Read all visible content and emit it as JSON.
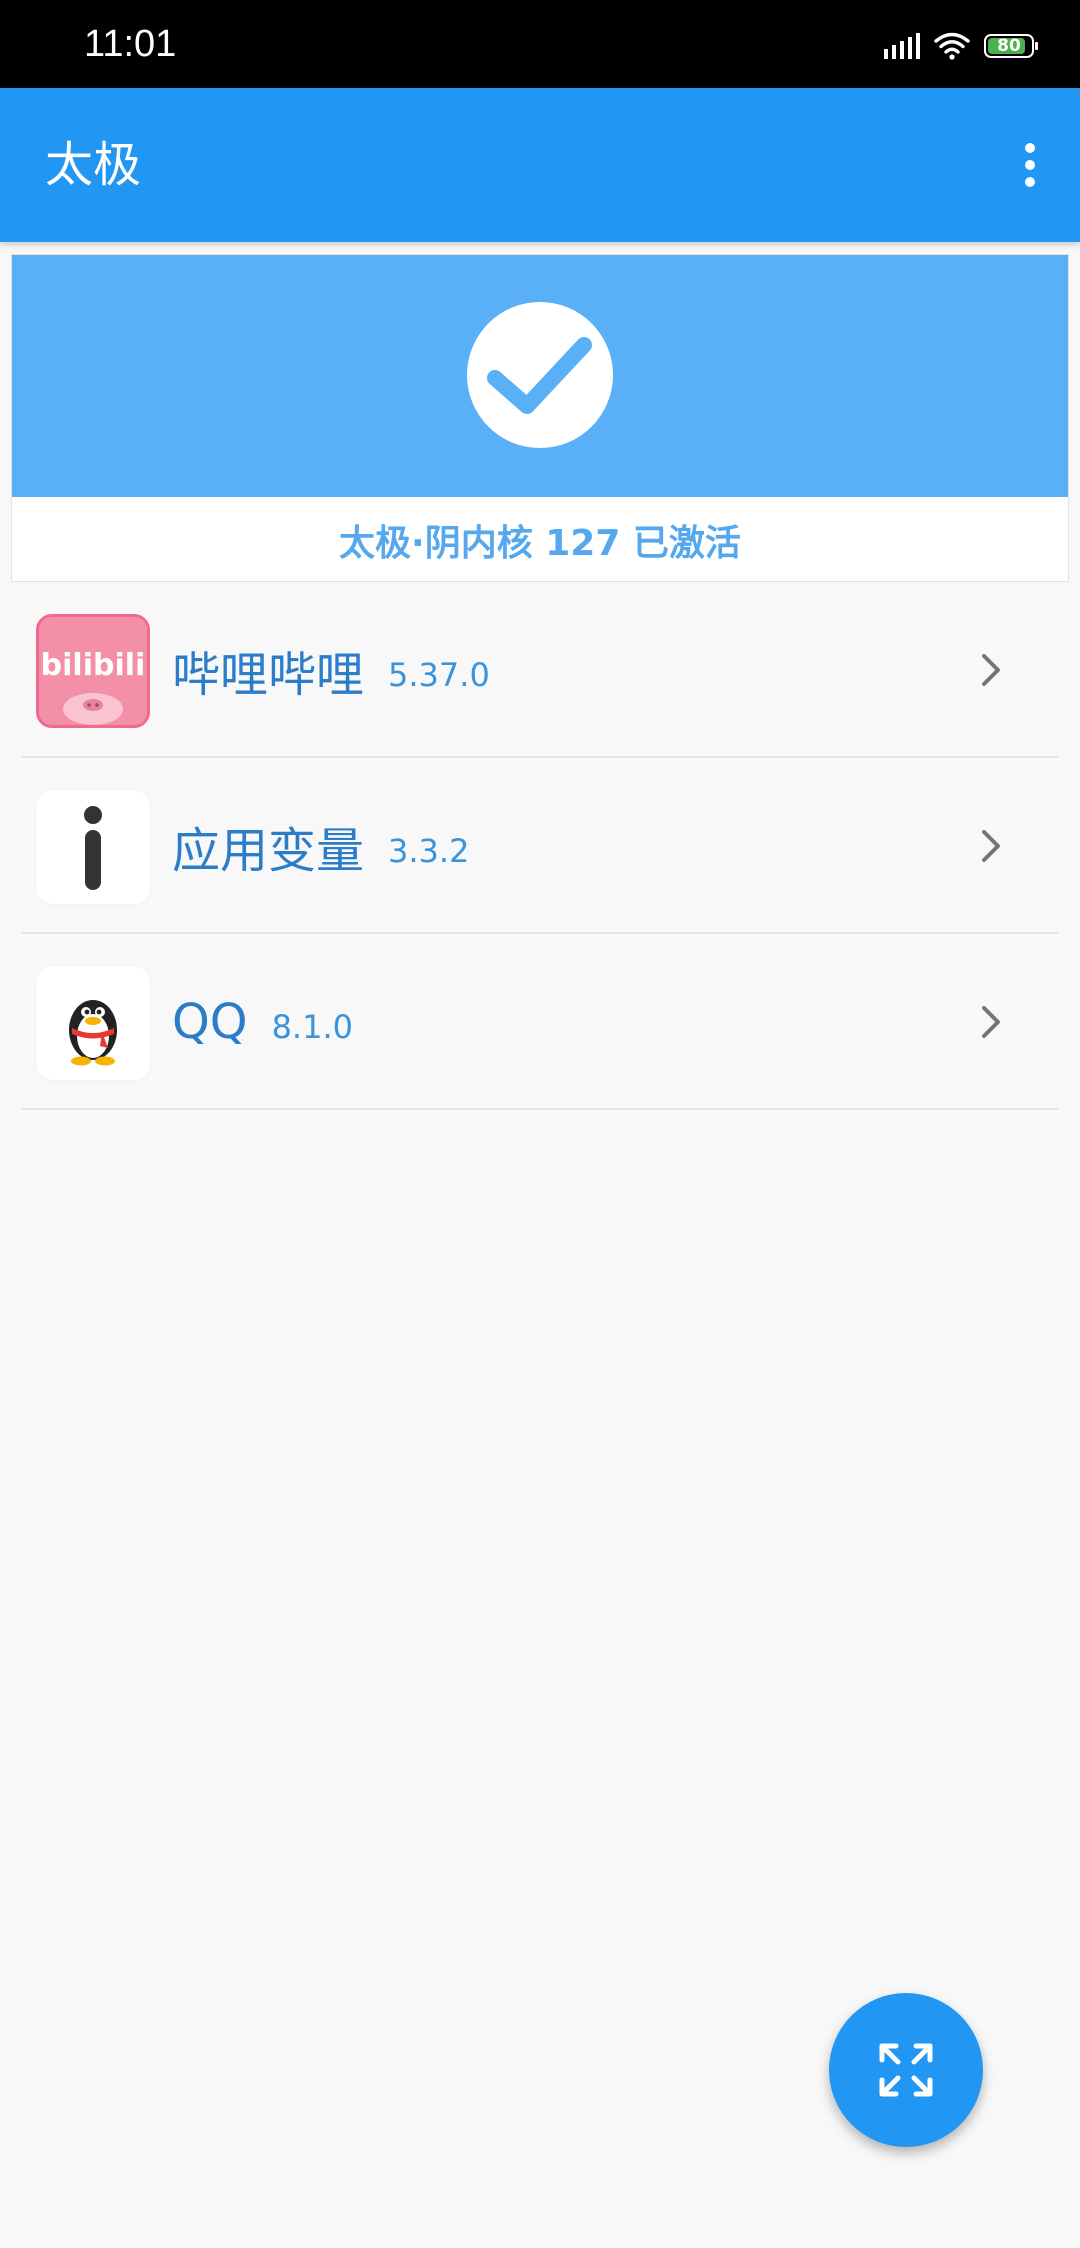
{
  "status_bar": {
    "time": "11:01",
    "battery_level": "80",
    "icons": [
      "signal-icon",
      "wifi-icon",
      "battery-icon"
    ]
  },
  "app_bar": {
    "title": "太极",
    "menu_icon": "more-vertical-icon"
  },
  "status_card": {
    "icon": "check-icon",
    "text": "太极·阴内核 127 已激活"
  },
  "apps": [
    {
      "name": "哔哩哔哩",
      "version": "5.37.0",
      "icon": "bilibili-app-icon"
    },
    {
      "name": "应用变量",
      "version": "3.3.2",
      "icon": "info-app-icon"
    },
    {
      "name": "QQ",
      "version": "8.1.0",
      "icon": "qq-app-icon"
    }
  ],
  "fab": {
    "icon": "expand-icon"
  },
  "colors": {
    "primary": "#2196f3",
    "card_header": "#59b0f6",
    "status_text": "#56a8ee",
    "app_name": "#2b7cc9"
  }
}
